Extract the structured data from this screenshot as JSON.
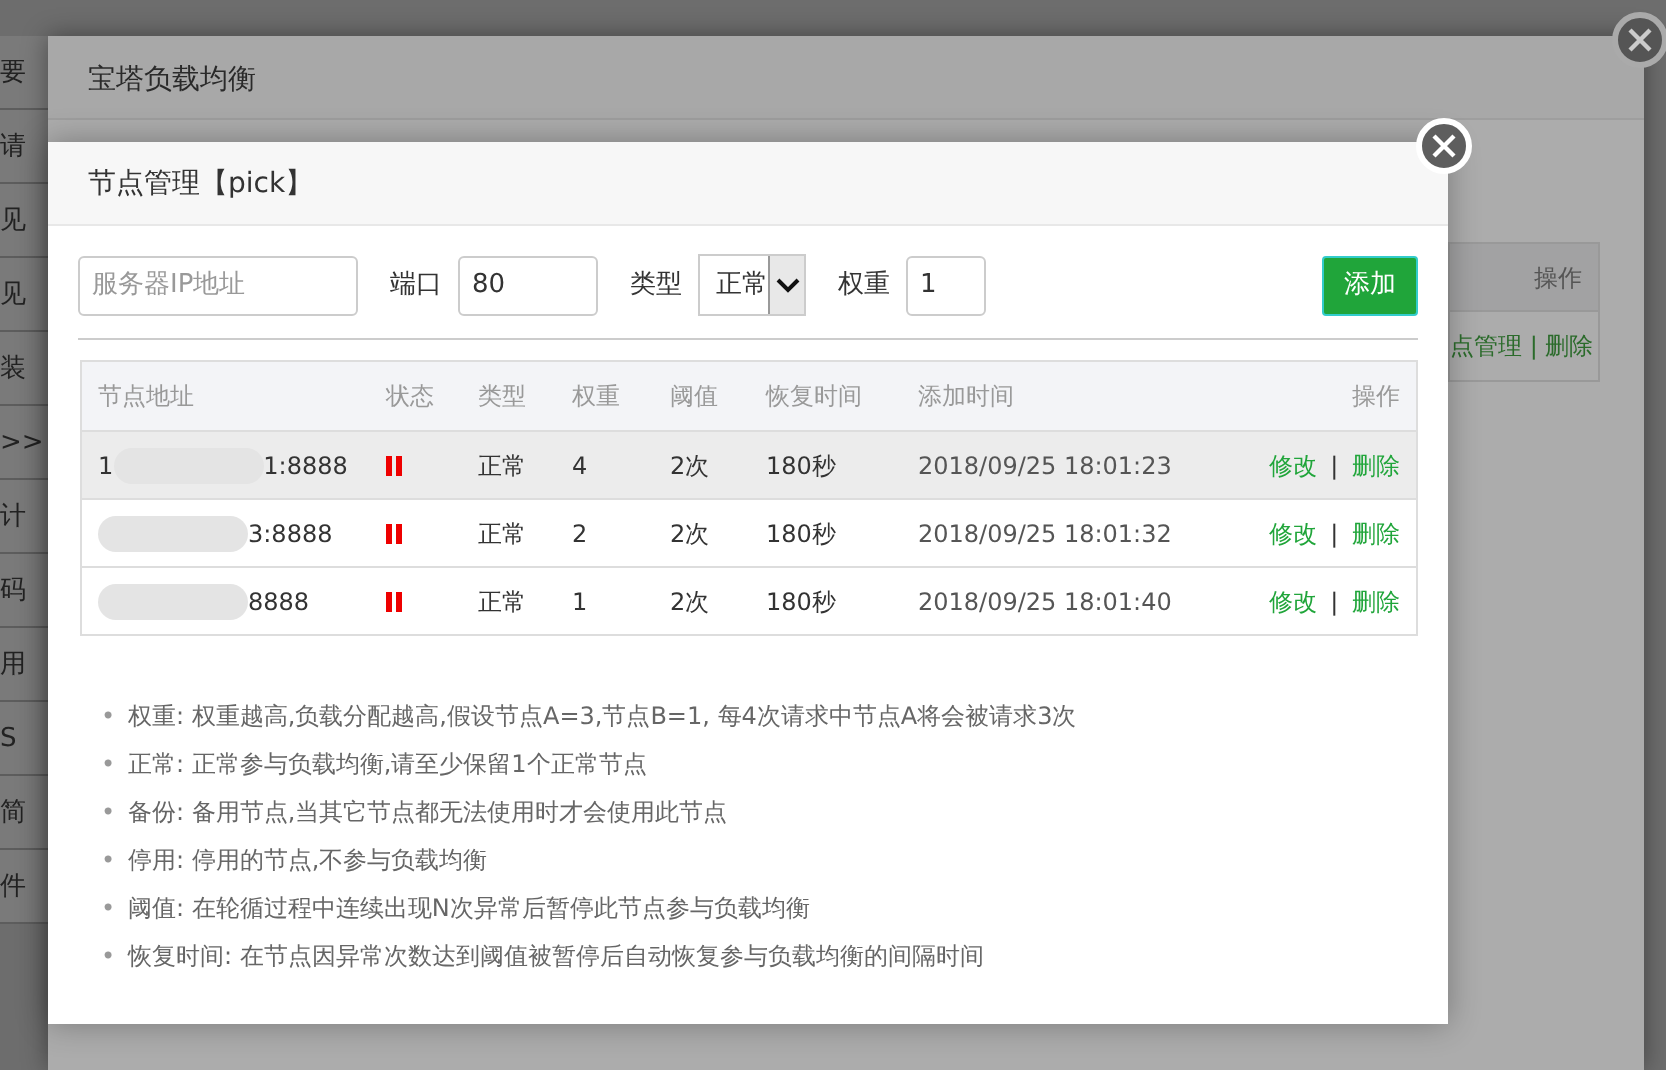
{
  "background_sidebar": [
    "要",
    "请",
    "见",
    "见",
    "装",
    ">>",
    "计",
    "码",
    "用",
    "S",
    "简",
    "件"
  ],
  "outer_dialog": {
    "title": "宝塔负载均衡",
    "table_header": "操作",
    "row_links": [
      "点管理",
      "|",
      "删除"
    ]
  },
  "dialog": {
    "title": "节点管理【pick】",
    "form": {
      "ip": {
        "placeholder": "服务器IP地址"
      },
      "port": {
        "label": "端口",
        "value": "80"
      },
      "type": {
        "label": "类型",
        "value": "正常"
      },
      "weight": {
        "label": "权重",
        "value": "1"
      },
      "add_button": "添加"
    },
    "table": {
      "columns": [
        "节点地址",
        "状态",
        "类型",
        "权重",
        "阈值",
        "恢复时间",
        "添加时间",
        "操作"
      ],
      "rows": [
        {
          "address_prefix": "1",
          "address_suffix": "1:8888",
          "type": "正常",
          "weight": "4",
          "threshold": "2次",
          "recovery": "180秒",
          "added": "2018/09/25 18:01:23",
          "actions": [
            "修改",
            "|",
            "删除"
          ],
          "selected": true
        },
        {
          "address_suffix": "3:8888",
          "type": "正常",
          "weight": "2",
          "threshold": "2次",
          "recovery": "180秒",
          "added": "2018/09/25 18:01:32",
          "actions": [
            "修改",
            "|",
            "删除"
          ],
          "selected": false
        },
        {
          "address_suffix": "8888",
          "type": "正常",
          "weight": "1",
          "threshold": "2次",
          "recovery": "180秒",
          "added": "2018/09/25 18:01:40",
          "actions": [
            "修改",
            "|",
            "删除"
          ],
          "selected": false
        }
      ]
    },
    "notes": [
      {
        "bullet": "•",
        "text": "权重: 权重越高,负载分配越高,假设节点A=3,节点B=1, 每4次请求中节点A将会被请求3次"
      },
      {
        "bullet": "•",
        "text": "正常: 正常参与负载均衡,请至少保留1个正常节点"
      },
      {
        "bullet": "•",
        "text": "备份: 备用节点,当其它节点都无法使用时才会使用此节点"
      },
      {
        "bullet": "•",
        "text": "停用: 停用的节点,不参与负载均衡"
      },
      {
        "bullet": "•",
        "text": "阈值: 在轮循过程中连续出现N次异常后暂停此节点参与负载均衡"
      },
      {
        "bullet": "•",
        "text": "恢复时间: 在节点因异常次数达到阈值被暂停后自动恢复参与负载均衡的间隔时间"
      }
    ]
  }
}
